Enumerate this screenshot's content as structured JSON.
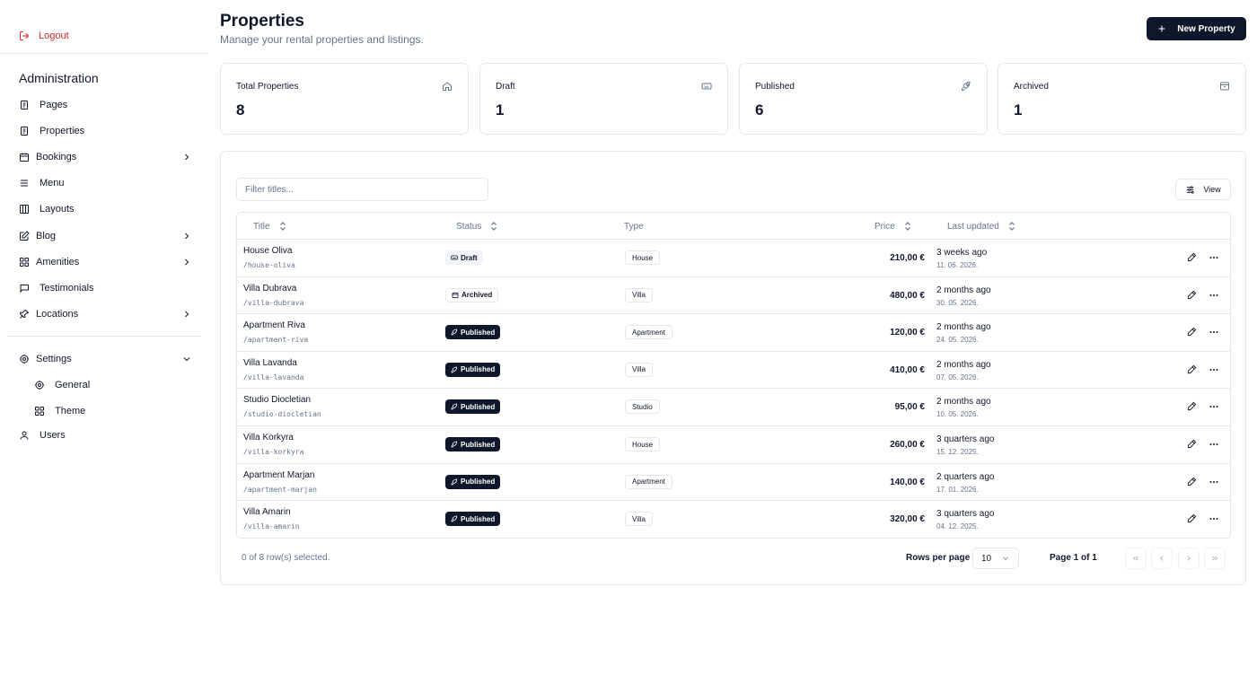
{
  "sidebar": {
    "logout": "Logout",
    "section_title": "Administration",
    "items": [
      {
        "label": "Pages",
        "icon": "page-icon"
      },
      {
        "label": "Properties",
        "icon": "page-icon"
      },
      {
        "label": "Bookings",
        "icon": "calendar-icon",
        "chevron": true
      },
      {
        "label": "Menu",
        "icon": "menu-icon"
      },
      {
        "label": "Layouts",
        "icon": "columns-icon"
      },
      {
        "label": "Blog",
        "icon": "edit-box-icon",
        "chevron": true
      },
      {
        "label": "Amenities",
        "icon": "grid-icon",
        "chevron": true
      },
      {
        "label": "Testimonials",
        "icon": "message-icon"
      },
      {
        "label": "Locations",
        "icon": "pin-icon",
        "chevron": true
      }
    ],
    "settings": {
      "label": "Settings",
      "children": [
        {
          "label": "General",
          "icon": "gear-icon"
        },
        {
          "label": "Theme",
          "icon": "grid-icon"
        }
      ]
    },
    "users": "Users"
  },
  "header": {
    "title": "Properties",
    "subtitle": "Manage your rental properties and listings.",
    "new_button": "New Property"
  },
  "stats": [
    {
      "title": "Total Properties",
      "value": "8",
      "icon": "home-icon"
    },
    {
      "title": "Draft",
      "value": "1",
      "icon": "keyboard-icon"
    },
    {
      "title": "Published",
      "value": "6",
      "icon": "rocket-icon"
    },
    {
      "title": "Archived",
      "value": "1",
      "icon": "archive-icon"
    }
  ],
  "table": {
    "filter_placeholder": "Filter titles...",
    "view_button": "View",
    "columns": {
      "title": "Title",
      "status": "Status",
      "type": "Type",
      "price": "Price",
      "updated": "Last updated"
    },
    "rows": [
      {
        "title": "House Oliva",
        "slug": "/house-oliva",
        "status": "Draft",
        "type": "House",
        "price": "210,00 €",
        "updated": "3 weeks ago",
        "date": "11. 06. 2026."
      },
      {
        "title": "Villa Dubrava",
        "slug": "/villa-dubrava",
        "status": "Archived",
        "type": "Villa",
        "price": "480,00 €",
        "updated": "2 months ago",
        "date": "30. 05. 2026."
      },
      {
        "title": "Apartment Riva",
        "slug": "/apartment-riva",
        "status": "Published",
        "type": "Apartment",
        "price": "120,00 €",
        "updated": "2 months ago",
        "date": "24. 05. 2026."
      },
      {
        "title": "Villa Lavanda",
        "slug": "/villa-lavanda",
        "status": "Published",
        "type": "Villa",
        "price": "410,00 €",
        "updated": "2 months ago",
        "date": "07. 05. 2026."
      },
      {
        "title": "Studio Diocletian",
        "slug": "/studio-diocletian",
        "status": "Published",
        "type": "Studio",
        "price": "95,00 €",
        "updated": "2 months ago",
        "date": "10. 05. 2026."
      },
      {
        "title": "Villa Korkyra",
        "slug": "/villa-korkyra",
        "status": "Published",
        "type": "House",
        "price": "260,00 €",
        "updated": "3 quarters ago",
        "date": "15. 12. 2025."
      },
      {
        "title": "Apartment Marjan",
        "slug": "/apartment-marjan",
        "status": "Published",
        "type": "Apartment",
        "price": "140,00 €",
        "updated": "2 quarters ago",
        "date": "17. 01. 2026."
      },
      {
        "title": "Villa Amarin",
        "slug": "/villa-amarin",
        "status": "Published",
        "type": "Villa",
        "price": "320,00 €",
        "updated": "3 quarters ago",
        "date": "04. 12. 2025."
      }
    ]
  },
  "footer": {
    "selection": "0 of 8 row(s) selected.",
    "rows_per_page_label": "Rows per page",
    "rows_per_page_value": "10",
    "page_info": "Page 1 of 1"
  },
  "colors": {
    "accent": "#0f172a",
    "danger": "#dc2626",
    "muted": "#64748b",
    "border": "#e5e7eb"
  }
}
